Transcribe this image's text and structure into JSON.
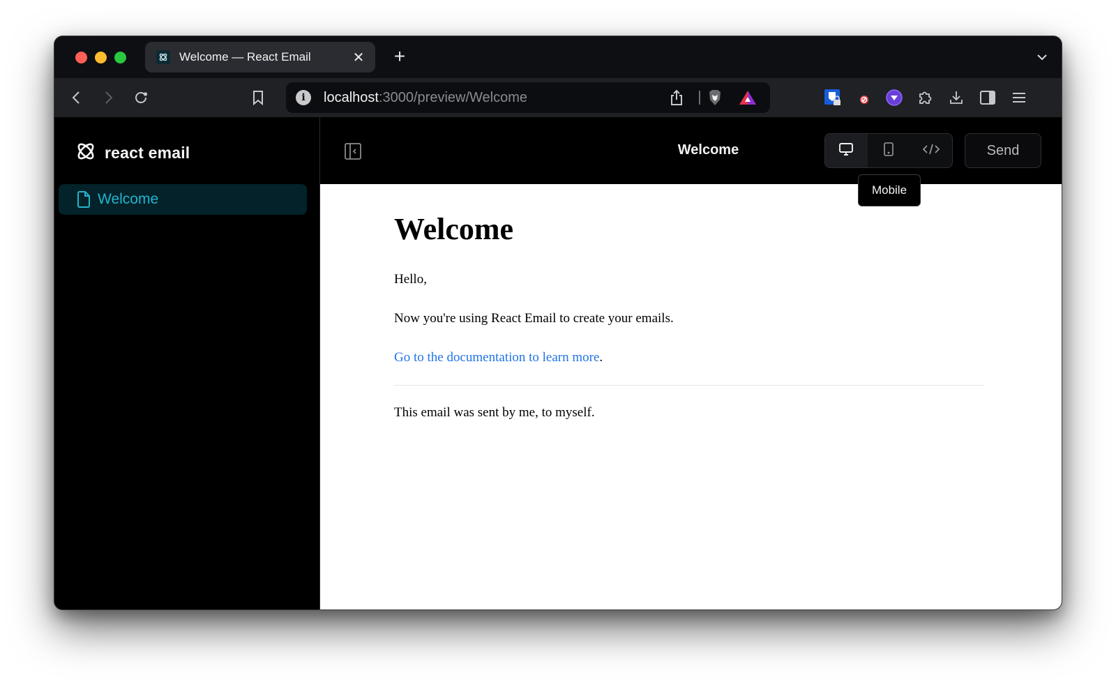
{
  "browser": {
    "tab": {
      "title": "Welcome — React Email",
      "close_glyph": "✕"
    },
    "new_tab_glyph": "+",
    "url": {
      "host": "localhost",
      "rest": ":3000/preview/Welcome"
    },
    "extensions": [
      "bitwarden-icon",
      "adblock-icon",
      "vpn-icon",
      "extensions-puzzle-icon",
      "downloads-icon",
      "sidebar-icon",
      "menu-icon"
    ]
  },
  "sidebar": {
    "logo_text": "react email",
    "items": [
      {
        "label": "Welcome",
        "active": true
      }
    ]
  },
  "preview": {
    "title": "Welcome",
    "views": [
      {
        "name": "desktop",
        "active": true
      },
      {
        "name": "mobile",
        "active": false
      },
      {
        "name": "code",
        "active": false
      }
    ],
    "send_label": "Send",
    "tooltip": "Mobile"
  },
  "email": {
    "heading": "Welcome",
    "greeting": "Hello,",
    "body": "Now you're using React Email to create your emails.",
    "link_text": "Go to the documentation to learn more",
    "link_suffix": ".",
    "footer": "This email was sent by me, to myself."
  },
  "colors": {
    "accent": "#22b4cf",
    "active_nav_bg": "#032229",
    "link": "#2174e8"
  }
}
